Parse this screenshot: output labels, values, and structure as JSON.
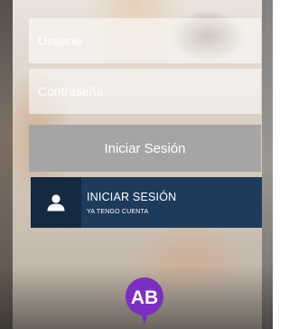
{
  "form": {
    "username_placeholder": "Usuario",
    "password_placeholder": "Contraseña",
    "login_label": "Iniciar Sesión"
  },
  "account_button": {
    "title": "INICIAR SESIÓN",
    "subtitle": "YA TENGO CUENTA",
    "icon": "user-icon"
  },
  "logo": {
    "text": "AB",
    "color": "#7b2fc0"
  },
  "colors": {
    "login_button": "#a5a5a5",
    "account_button": "#1e3a5c",
    "account_icon_box": "#15293f"
  }
}
